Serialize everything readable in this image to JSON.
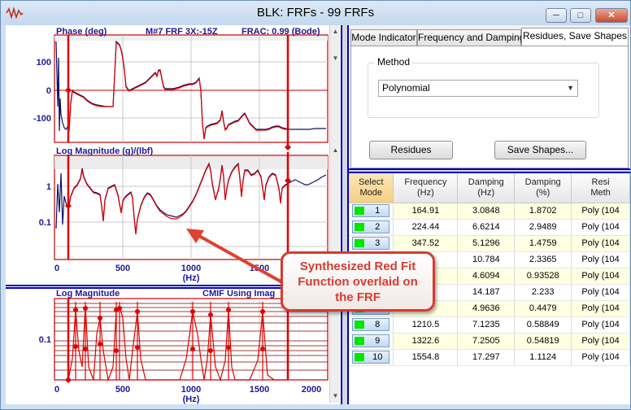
{
  "window": {
    "title": "BLK: FRFs - 99 FRFs"
  },
  "plots": {
    "phase": {
      "title": "Phase (deg)",
      "info1": "M#7 FRF 3X:-15Z",
      "info2": "FRAC: 0.99 (Bode)",
      "yticks": [
        "100",
        "0",
        "-100"
      ]
    },
    "magnitude": {
      "title": "Log Magnitude (g)/(lbf)",
      "yticks": [
        "1",
        "0.1"
      ],
      "xticks": [
        "0",
        "500",
        "1000",
        "1500"
      ],
      "xunit": "(Hz)"
    },
    "cmif": {
      "title": "Log Magnitude",
      "subtitle": "CMIF Using Imag",
      "yticks": [
        "0.1"
      ],
      "xticks": [
        "0",
        "500",
        "1000",
        "1500",
        "2000"
      ],
      "xunit": "(Hz)"
    }
  },
  "callout": {
    "line1": "Synthesized Red Fit",
    "line2": "Function overlaid on",
    "line3": "the FRF",
    "color": "#d63b2e"
  },
  "tabs": [
    {
      "label": "Mode Indicator"
    },
    {
      "label": "Frequency and Damping"
    },
    {
      "label": "Residues, Save Shapes",
      "active": true
    }
  ],
  "method": {
    "label": "Method",
    "value": "Polynomial"
  },
  "buttons": {
    "residues": "Residues",
    "save_shapes": "Save Shapes..."
  },
  "table": {
    "headers": {
      "select": [
        "Select",
        "Mode"
      ],
      "frequency": [
        "Frequency",
        "(Hz)"
      ],
      "damping_hz": [
        "Damping",
        "(Hz)"
      ],
      "damping_pct": [
        "Damping",
        "(%)"
      ],
      "method": [
        "Resi",
        "Meth"
      ]
    },
    "rows": [
      {
        "mode": "1",
        "freq": "164.91",
        "damp_hz": "3.0848",
        "damp_pct": "1.8702",
        "method": "Poly (104"
      },
      {
        "mode": "2",
        "freq": "224.44",
        "damp_hz": "6.6214",
        "damp_pct": "2.9489",
        "method": "Poly (104"
      },
      {
        "mode": "3",
        "freq": "347.52",
        "damp_hz": "5.1296",
        "damp_pct": "1.4759",
        "method": "Poly (104"
      },
      {
        "mode": "4",
        "freq": "4",
        "damp_hz": "10.784",
        "damp_pct": "2.3365",
        "method": "Poly (104"
      },
      {
        "mode": "5",
        "freq": "",
        "damp_hz": "4.6094",
        "damp_pct": "0.93528",
        "method": "Poly (104"
      },
      {
        "mode": "6",
        "freq": "",
        "damp_hz": "14.187",
        "damp_pct": "2.233",
        "method": "Poly (104"
      },
      {
        "mode": "7",
        "freq": "2",
        "damp_hz": "4.9636",
        "damp_pct": "0.4479",
        "method": "Poly (104"
      },
      {
        "mode": "8",
        "freq": "1210.5",
        "damp_hz": "7.1235",
        "damp_pct": "0.58849",
        "method": "Poly (104"
      },
      {
        "mode": "9",
        "freq": "1322.6",
        "damp_hz": "7.2505",
        "damp_pct": "0.54819",
        "method": "Poly (104"
      },
      {
        "mode": "10",
        "freq": "1554.8",
        "damp_hz": "17.297",
        "damp_pct": "1.1124",
        "method": "Poly (104"
      }
    ]
  }
}
